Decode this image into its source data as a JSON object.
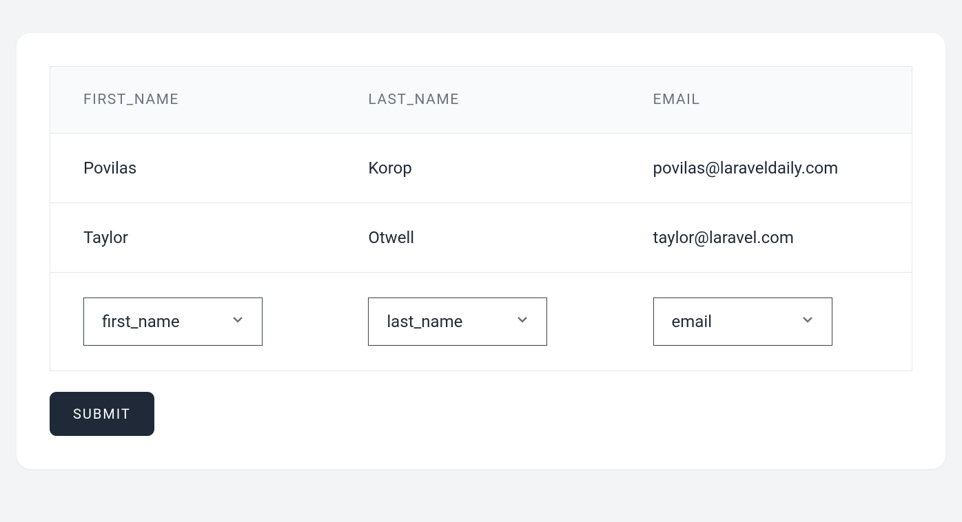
{
  "table": {
    "headers": {
      "first_name": "FIRST_NAME",
      "last_name": "LAST_NAME",
      "email": "EMAIL"
    },
    "rows": [
      {
        "first_name": "Povilas",
        "last_name": "Korop",
        "email": "povilas@laraveldaily.com"
      },
      {
        "first_name": "Taylor",
        "last_name": "Otwell",
        "email": "taylor@laravel.com"
      }
    ],
    "selects": {
      "first_name": {
        "value": "first_name"
      },
      "last_name": {
        "value": "last_name"
      },
      "email": {
        "value": "email"
      }
    }
  },
  "buttons": {
    "submit": "SUBMIT"
  }
}
